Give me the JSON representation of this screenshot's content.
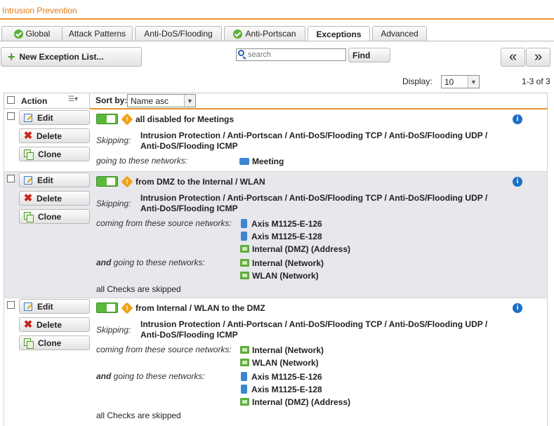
{
  "page": {
    "title": "Intrusion Prevention"
  },
  "tabs": [
    {
      "label": "Global",
      "status": "ok"
    },
    {
      "label": "Attack Patterns"
    },
    {
      "label": "Anti-DoS/Flooding"
    },
    {
      "label": "Anti-Portscan",
      "status": "ok"
    },
    {
      "label": "Exceptions",
      "active": true
    },
    {
      "label": "Advanced"
    }
  ],
  "toolbar": {
    "new_button": "New Exception List...",
    "search_placeholder": "search",
    "find_button": "Find",
    "prev_button": "«",
    "next_button": "»",
    "display_label": "Display:",
    "display_value": "10",
    "range": "1-3 of 3"
  },
  "table": {
    "action_header": "Action",
    "sort_label": "Sort by:",
    "sort_value": "Name asc"
  },
  "row_actions": {
    "edit": "Edit",
    "delete": "Delete",
    "clone": "Clone"
  },
  "rows": [
    {
      "title": "all disabled for Meetings",
      "skipping_label": "Skipping:",
      "skipping": "Intrusion Protection / Anti-Portscan / Anti-DoS/Flooding TCP / Anti-DoS/Flooding UDP / Anti-DoS/Flooding ICMP",
      "dest_label": "going to these networks:",
      "dest": [
        "Meeting"
      ]
    },
    {
      "title": "from DMZ to the Internal / WLAN",
      "skipping_label": "Skipping:",
      "skipping": "Intrusion Protection / Anti-Portscan / Anti-DoS/Flooding TCP / Anti-DoS/Flooding UDP / Anti-DoS/Flooding ICMP",
      "src_label": "coming from these source networks:",
      "src": [
        "Axis M1125-E-126",
        "Axis M1125-E-128",
        "Internal (DMZ) (Address)"
      ],
      "dest_label_and": "and",
      "dest_label_rest": " going to these networks:",
      "dest": [
        "Internal (Network)",
        "WLAN (Network)"
      ],
      "footer": "all Checks are skipped"
    },
    {
      "title": "from Internal / WLAN to the DMZ",
      "skipping_label": "Skipping:",
      "skipping": "Intrusion Protection / Anti-Portscan / Anti-DoS/Flooding TCP / Anti-DoS/Flooding UDP / Anti-DoS/Flooding ICMP",
      "src_label": "coming from these source networks:",
      "src": [
        "Internal (Network)",
        "WLAN (Network)"
      ],
      "dest_label_and": "and",
      "dest_label_rest": " going to these networks:",
      "dest": [
        "Axis M1125-E-126",
        "Axis M1125-E-128",
        "Internal (DMZ) (Address)"
      ],
      "footer": "all Checks are skipped"
    }
  ],
  "info_symbol": "i",
  "warn_symbol": "!"
}
